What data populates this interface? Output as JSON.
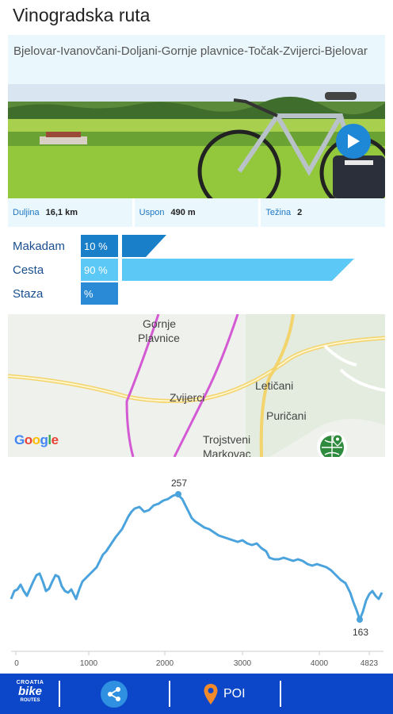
{
  "page_title": "Vinogradska ruta",
  "route_description": "Bjelovar-Ivanovčani-Doljani-Gornje plavnice-Točak-Zvijerci-Bjelovar",
  "stats": [
    {
      "label": "Duljina",
      "value": "16,1 km"
    },
    {
      "label": "Uspon",
      "value": "490 m"
    },
    {
      "label": "Težina",
      "value": "2"
    }
  ],
  "surfaces": [
    {
      "label": "Makadam",
      "percent_text": "10 %",
      "percent": 10,
      "color": "#1a7fc9"
    },
    {
      "label": "Cesta",
      "percent_text": "90 %",
      "percent": 90,
      "color": "#5bc8f5"
    },
    {
      "label": "Staza",
      "percent_text": "%",
      "percent": 0,
      "color": "#2a8ad6"
    }
  ],
  "map": {
    "places": [
      "Gornje",
      "Plavnice",
      "Zvijerci",
      "Letičani",
      "Puričani",
      "Trojstveni",
      "Markovac"
    ],
    "attribution": "Google",
    "pin_icon": "map-location-icon"
  },
  "elevation": {
    "max_label": "257",
    "min_label": "163",
    "x_ticks": [
      "0",
      "1000",
      "2000",
      "3000",
      "4000",
      "4823"
    ],
    "line_color": "#4aa3dc"
  },
  "bottom_bar": {
    "logo_top": "CROATIA",
    "logo_main": "bike",
    "logo_bottom": "ROUTES",
    "share_icon": "share-icon",
    "poi_label": "POI",
    "poi_icon": "map-marker-icon"
  },
  "colors": {
    "accent": "#1e88d6",
    "bottom_bar": "#0b47c8",
    "panel_bg": "#eaf7fd"
  }
}
